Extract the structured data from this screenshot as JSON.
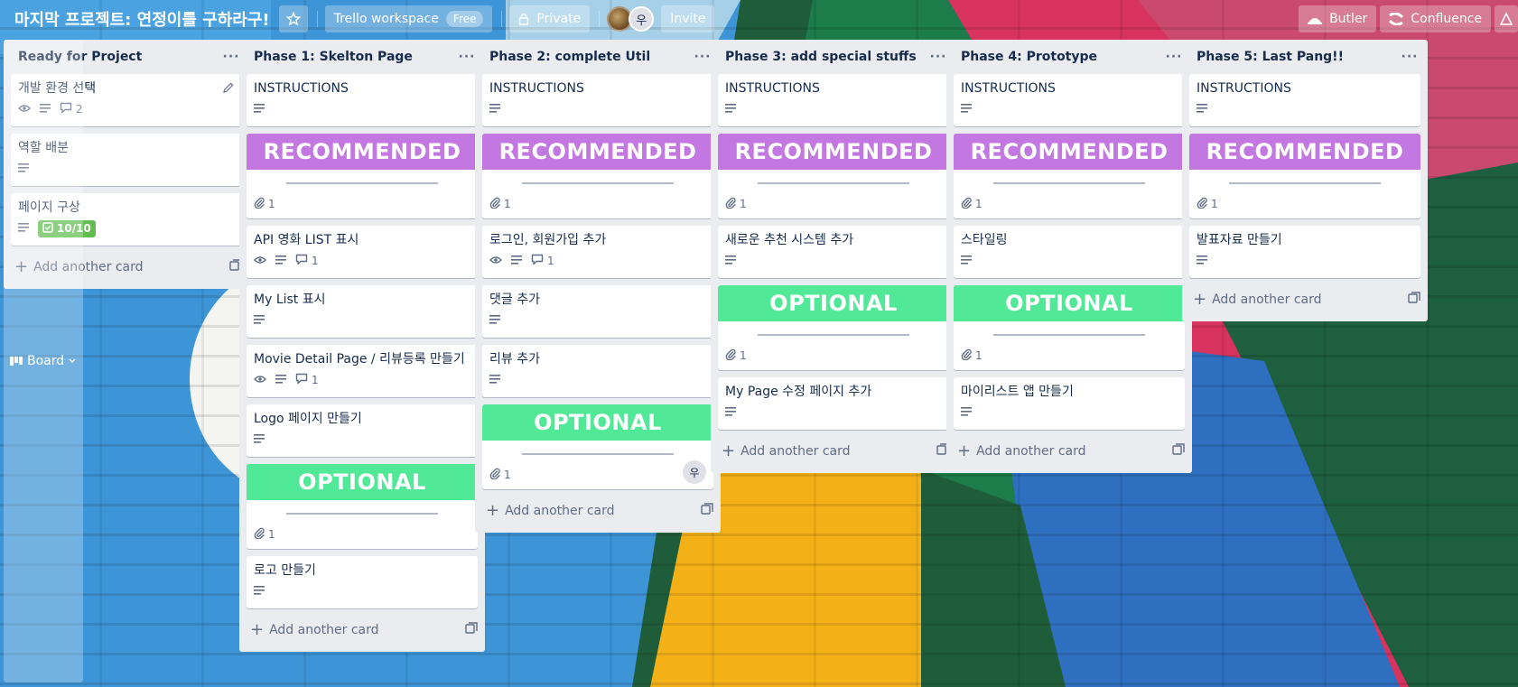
{
  "header": {
    "board_switch_label": "Board",
    "title": "마지막 프로젝트: 연정이를 구하라구!",
    "workspace_label": "Trello workspace",
    "workspace_badge": "Free",
    "visibility_label": "Private",
    "member_initial": "우",
    "invite_label": "Invite",
    "butler_label": "Butler",
    "confluence_label": "Confluence"
  },
  "add_card_label": "Add another card",
  "colors": {
    "recommended": "#c377e0",
    "optional": "#51e898",
    "checklist_complete": "#61bd4f",
    "list_bg": "#ebecf0"
  },
  "lists": [
    {
      "title": "Ready for Project",
      "cards": [
        {
          "title": "개발 환경 선택",
          "watch": true,
          "desc": true,
          "comments": "2",
          "edit": true
        },
        {
          "title": "역할 배분",
          "desc": true
        },
        {
          "title": "페이지 구상",
          "desc": true,
          "checklist": "10/10"
        }
      ]
    },
    {
      "title": "Phase 1: Skelton Page",
      "cards": [
        {
          "title": "INSTRUCTIONS",
          "desc": true
        },
        {
          "cover": "RECOMMENDED",
          "attachments": "1"
        },
        {
          "title": "API 영화 LIST 표시",
          "watch": true,
          "desc": true,
          "comments": "1"
        },
        {
          "title": "My List 표시",
          "desc": true
        },
        {
          "title": "Movie Detail Page / 리뷰등록 만들기",
          "watch": true,
          "desc": true,
          "comments": "1"
        },
        {
          "title": "Logo 페이지 만들기",
          "desc": true
        },
        {
          "cover": "OPTIONAL",
          "attachments": "1"
        },
        {
          "title": "로고 만들기",
          "desc": true
        }
      ]
    },
    {
      "title": "Phase 2: complete Util",
      "cards": [
        {
          "title": "INSTRUCTIONS",
          "desc": true
        },
        {
          "cover": "RECOMMENDED",
          "attachments": "1"
        },
        {
          "title": "로그인, 회원가입 추가",
          "watch": true,
          "desc": true,
          "comments": "1"
        },
        {
          "title": "댓글 추가",
          "desc": true
        },
        {
          "title": "리뷰 추가",
          "desc": true
        },
        {
          "cover": "OPTIONAL",
          "attachments": "1",
          "member": "우"
        }
      ]
    },
    {
      "title": "Phase 3: add special stuffs",
      "cards": [
        {
          "title": "INSTRUCTIONS",
          "desc": true
        },
        {
          "cover": "RECOMMENDED",
          "attachments": "1"
        },
        {
          "title": "새로운 추천 시스템 추가",
          "desc": true
        },
        {
          "cover": "OPTIONAL",
          "attachments": "1"
        },
        {
          "title": "My Page 수정 페이지 추가",
          "desc": true
        }
      ]
    },
    {
      "title": "Phase 4: Prototype",
      "cards": [
        {
          "title": "INSTRUCTIONS",
          "desc": true
        },
        {
          "cover": "RECOMMENDED",
          "attachments": "1"
        },
        {
          "title": "스타일링",
          "desc": true
        },
        {
          "cover": "OPTIONAL",
          "attachments": "1"
        },
        {
          "title": "마이리스트 앱 만들기",
          "desc": true
        }
      ]
    },
    {
      "title": "Phase 5: Last Pang!!",
      "cards": [
        {
          "title": "INSTRUCTIONS",
          "desc": true
        },
        {
          "cover": "RECOMMENDED",
          "attachments": "1"
        },
        {
          "title": "발표자료 만들기",
          "desc": true
        }
      ]
    }
  ]
}
